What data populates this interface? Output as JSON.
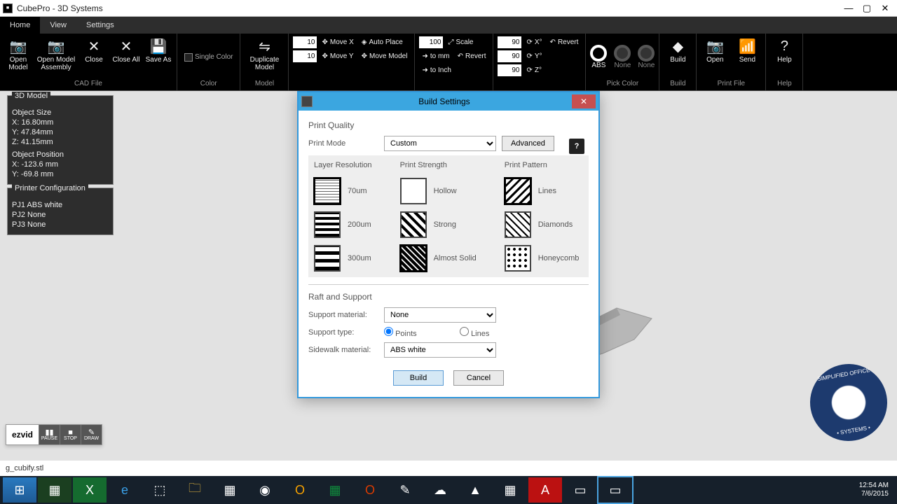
{
  "window": {
    "title": "CubePro - 3D Systems"
  },
  "menubar": {
    "tabs": [
      "Home",
      "View",
      "Settings"
    ],
    "active": 0
  },
  "ribbon": {
    "cad": {
      "label": "CAD File",
      "open": "Open Model",
      "openasm": "Open Model Assembly",
      "close": "Close",
      "closeall": "Close All",
      "saveas": "Save As"
    },
    "color": {
      "label": "Color",
      "single": "Single Color"
    },
    "dup": {
      "label": "Model",
      "dup": "Duplicate Model"
    },
    "move": {
      "x": "10",
      "y": "10",
      "movex": "Move X",
      "movey": "Move Y",
      "autoplace": "Auto Place",
      "movemodel": "Move Model"
    },
    "scale": {
      "val": "100",
      "scale": "Scale",
      "tomm": "to mm",
      "toinch": "to Inch",
      "revert": "Revert"
    },
    "rotate": {
      "x": "90",
      "y": "90",
      "z": "90",
      "rx": "X°",
      "ry": "Y°",
      "rz": "Z°",
      "revert": "Revert"
    },
    "pick": {
      "label": "Pick Color",
      "abs": "ABS",
      "none": "None",
      "none2": "None"
    },
    "build": {
      "label": "Build",
      "build": "Build"
    },
    "printf": {
      "label": "Print File",
      "open": "Open",
      "send": "Send"
    },
    "help": {
      "label": "Help",
      "help": "Help"
    }
  },
  "side": {
    "model": {
      "title": "3D Model",
      "objsize": "Object Size",
      "x": "X:   16.80mm",
      "y": "Y:   47.84mm",
      "z": "Z:   41.15mm",
      "objpos": "Object Position",
      "px": "X:   -123.6 mm",
      "py": "Y:   -69.8 mm"
    },
    "printer": {
      "title": "Printer Configuration",
      "p1": "PJ1  ABS white",
      "p2": "PJ2  None",
      "p3": "PJ3  None"
    }
  },
  "statusbar": {
    "file": "g_cubify.stl"
  },
  "dialog": {
    "title": "Build Settings",
    "pq": "Print Quality",
    "printmode_lbl": "Print Mode",
    "printmode_val": "Custom",
    "advanced": "Advanced",
    "layer": "Layer Resolution",
    "strength": "Print Strength",
    "pattern": "Print Pattern",
    "layer_opts": [
      "70um",
      "200um",
      "300um"
    ],
    "strength_opts": [
      "Hollow",
      "Strong",
      "Almost Solid"
    ],
    "pattern_opts": [
      "Lines",
      "Diamonds",
      "Honeycomb"
    ],
    "layer_sel": 0,
    "strength_sel": 2,
    "pattern_sel": 0,
    "raft": "Raft and Support",
    "supportmat_lbl": "Support material:",
    "supportmat_val": "None",
    "supporttype_lbl": "Support type:",
    "supporttype_points": "Points",
    "supporttype_lines": "Lines",
    "sidewalk_lbl": "Sidewalk material:",
    "sidewalk_val": "ABS white",
    "build": "Build",
    "cancel": "Cancel"
  },
  "ezvid": {
    "logo": "ezvid",
    "pause": "PAUSE",
    "stop": "STOP",
    "draw": "DRAW"
  },
  "clock": {
    "time": "12:54 AM",
    "date": "7/6/2015"
  },
  "badge": {
    "top": "SIMPLIFIED OFFICE",
    "bottom": "• SYSTEMS •"
  }
}
